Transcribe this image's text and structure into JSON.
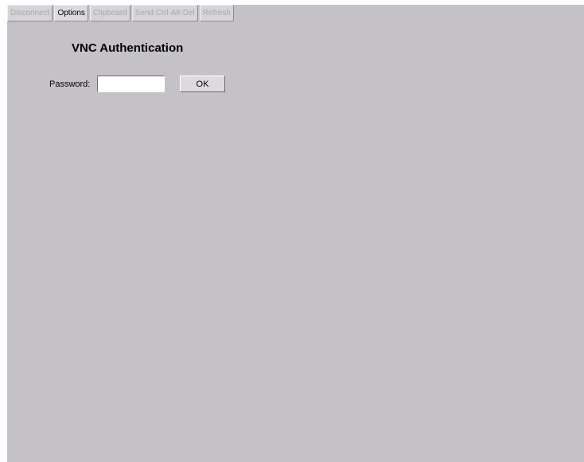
{
  "toolbar": {
    "buttons": [
      {
        "label": "Disconnect",
        "enabled": false
      },
      {
        "label": "Options",
        "enabled": true
      },
      {
        "label": "Clipboard",
        "enabled": false
      },
      {
        "label": "Send Ctrl-Alt-Del",
        "enabled": false
      },
      {
        "label": "Refresh",
        "enabled": false
      }
    ]
  },
  "auth": {
    "title": "VNC Authentication",
    "password_label": "Password:",
    "password_value": "",
    "ok_label": "OK"
  },
  "colors": {
    "background": "#c4c2c7",
    "button_face": "#dcdadf",
    "disabled_text": "#a9a7ac"
  }
}
